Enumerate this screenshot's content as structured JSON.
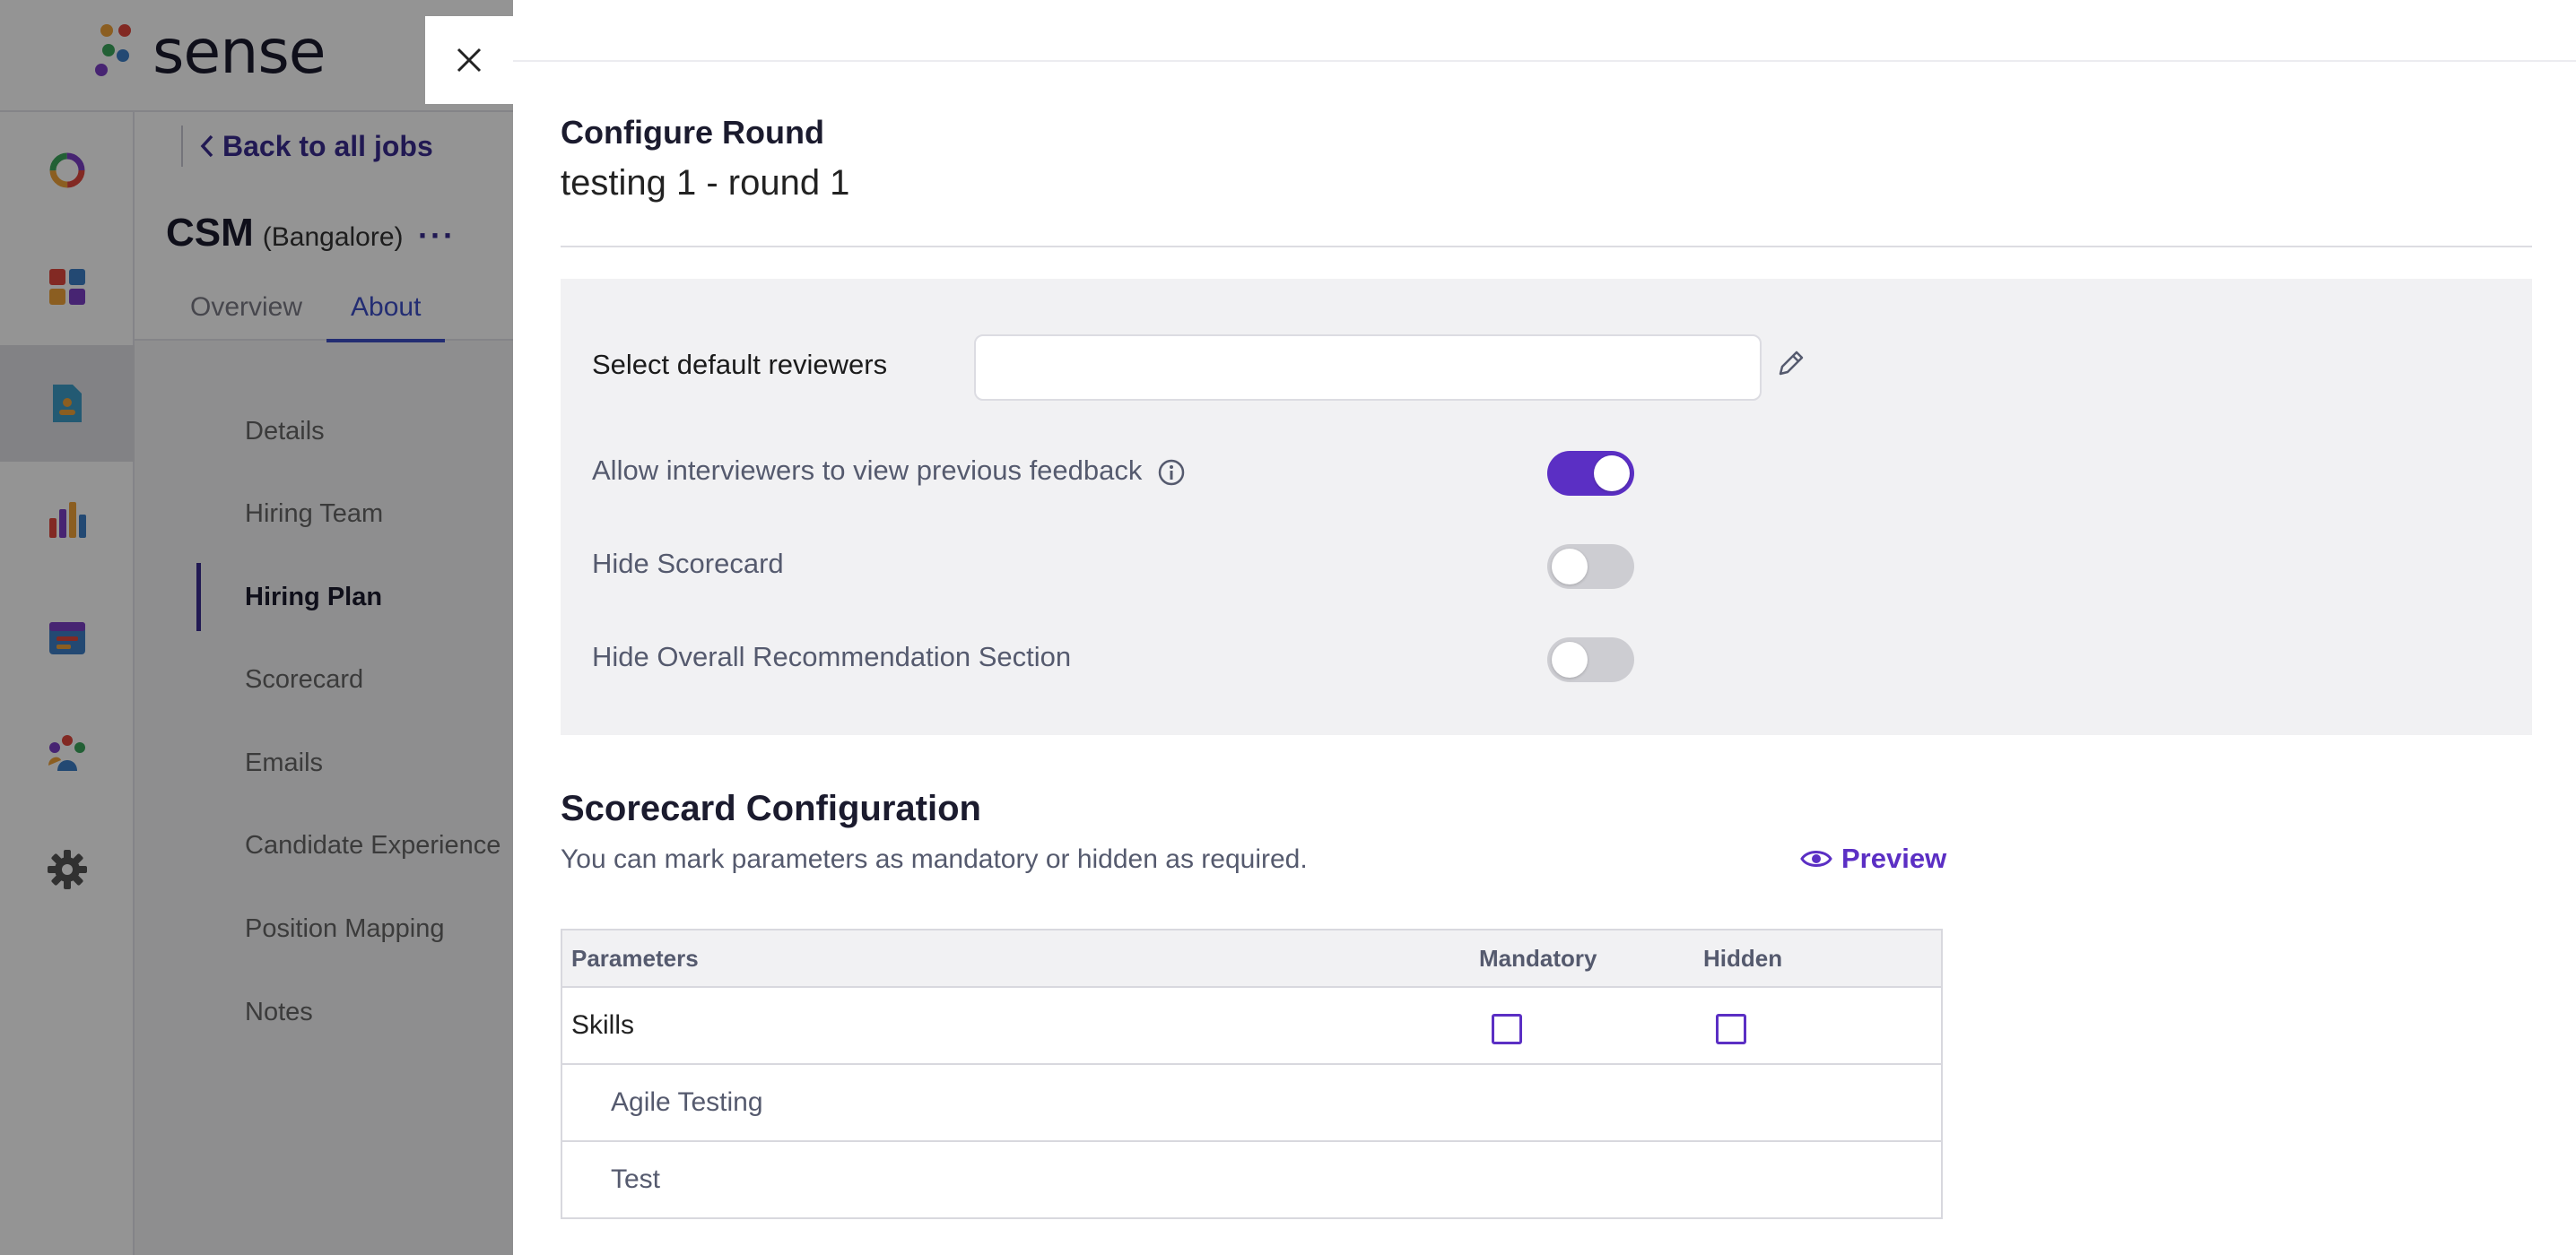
{
  "app": {
    "logo_text": "sense"
  },
  "colors": {
    "accent": "#5b2fc4",
    "link": "#3a2b8f",
    "tab_active": "#3d4fc7"
  },
  "sidebar": {
    "items": [
      {
        "icon": "dashboard-ring-icon"
      },
      {
        "icon": "apps-grid-icon"
      },
      {
        "icon": "jobs-document-icon",
        "active": true
      },
      {
        "icon": "analytics-bars-icon"
      },
      {
        "icon": "calendar-icon"
      },
      {
        "icon": "team-icon"
      },
      {
        "icon": "gear-icon"
      }
    ]
  },
  "job": {
    "back_label": "Back to all jobs",
    "title": "CSM",
    "location": "(Bangalore)",
    "more": "···",
    "tabs": [
      {
        "label": "Overview",
        "active": false
      },
      {
        "label": "About",
        "active": true
      }
    ]
  },
  "left_menu": {
    "items": [
      {
        "label": "Details"
      },
      {
        "label": "Hiring Team"
      },
      {
        "label": "Hiring Plan",
        "active": true
      },
      {
        "label": "Scorecard"
      },
      {
        "label": "Emails"
      },
      {
        "label": "Candidate Experience"
      },
      {
        "label": "Position Mapping"
      },
      {
        "label": "Notes"
      }
    ]
  },
  "drawer": {
    "title": "Configure Round",
    "subtitle": "testing 1 - round 1",
    "settings": {
      "reviewers_label": "Select default reviewers",
      "reviewers_value": "",
      "allow_prev_feedback_label": "Allow interviewers to view previous feedback",
      "allow_prev_feedback_on": true,
      "hide_scorecard_label": "Hide Scorecard",
      "hide_scorecard_on": false,
      "hide_overall_label": "Hide Overall Recommendation Section",
      "hide_overall_on": false
    },
    "scorecard": {
      "title": "Scorecard Configuration",
      "description": "You can mark parameters as mandatory or hidden as required.",
      "preview_label": "Preview",
      "columns": [
        "Parameters",
        "Mandatory",
        "Hidden"
      ],
      "rows": [
        {
          "name": "Skills",
          "group": true,
          "mandatory": false,
          "hidden": false
        },
        {
          "name": "Agile Testing",
          "group": false
        },
        {
          "name": "Test",
          "group": false
        }
      ]
    }
  }
}
